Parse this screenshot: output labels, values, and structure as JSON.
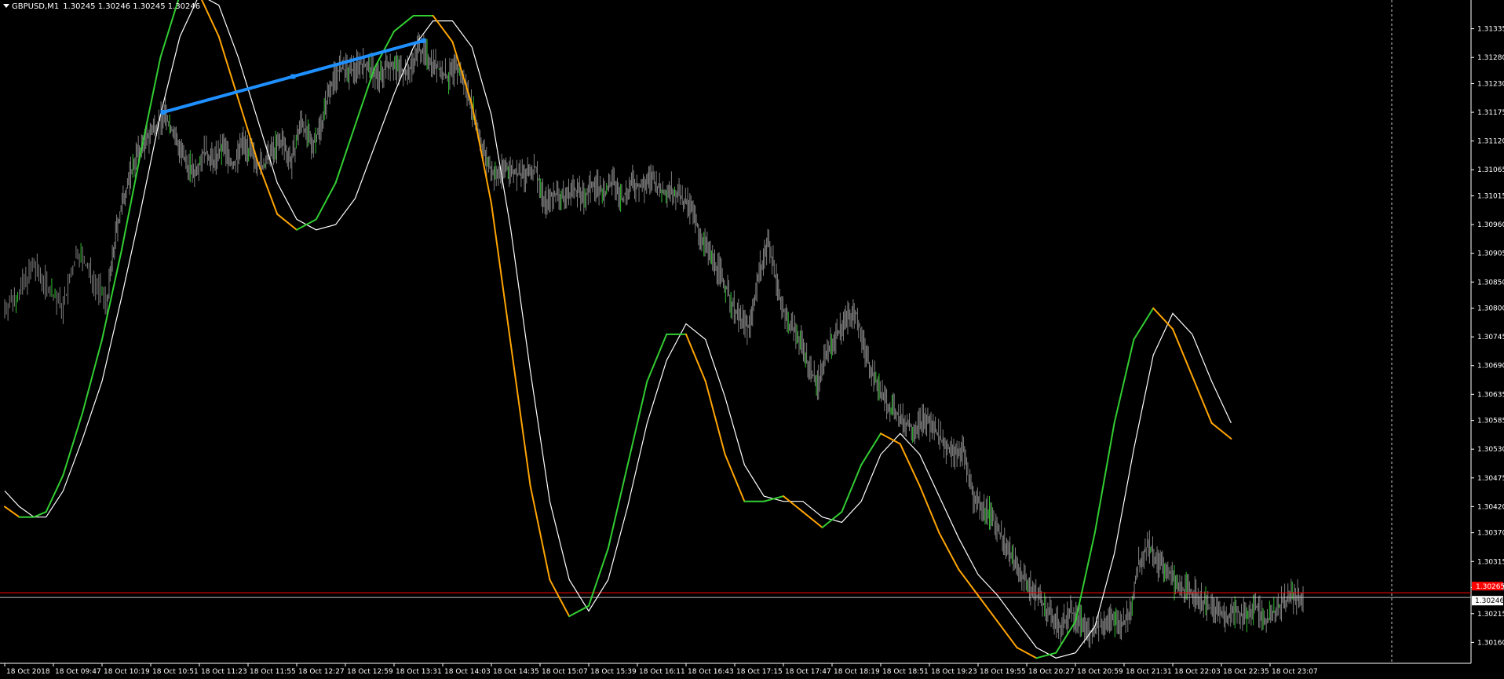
{
  "header": {
    "symbol": "GBPUSD,M1",
    "ohlc": "1.30245 1.30246 1.30245 1.30246"
  },
  "colors": {
    "background": "#000000",
    "axis": "#ffffff",
    "candles": "#808080",
    "bull_highlight": "#2ec02e",
    "slow_line": "#ffffff",
    "fast_line_up": "#32cd32",
    "fast_line_down": "#ffa500",
    "trendline": "#1e90ff",
    "price_line": "#ff0000",
    "current_price_line": "#c0c0c0"
  },
  "chart_data": {
    "type": "line",
    "instrument": "GBPUSD",
    "timeframe": "M1",
    "x_ticks": [
      "18 Oct 2018",
      "18 Oct 09:47",
      "18 Oct 10:19",
      "18 Oct 10:51",
      "18 Oct 11:23",
      "18 Oct 11:55",
      "18 Oct 12:27",
      "18 Oct 12:59",
      "18 Oct 13:31",
      "18 Oct 14:03",
      "18 Oct 14:35",
      "18 Oct 15:07",
      "18 Oct 15:39",
      "18 Oct 16:11",
      "18 Oct 16:43",
      "18 Oct 17:15",
      "18 Oct 17:47",
      "18 Oct 18:19",
      "18 Oct 18:51",
      "18 Oct 19:23",
      "18 Oct 19:55",
      "18 Oct 20:27",
      "18 Oct 20:59",
      "18 Oct 21:31",
      "18 Oct 22:03",
      "18 Oct 22:35",
      "18 Oct 23:07"
    ],
    "y_ticks": [
      "1.31335",
      "1.31280",
      "1.31230",
      "1.31175",
      "1.31120",
      "1.31065",
      "1.31015",
      "1.30960",
      "1.30905",
      "1.30850",
      "1.30800",
      "1.30745",
      "1.30690",
      "1.30635",
      "1.30585",
      "1.30530",
      "1.30475",
      "1.30420",
      "1.30370",
      "1.30315",
      "1.30265",
      "1.30215",
      "1.30160"
    ],
    "ylim": [
      1.3012,
      1.3139
    ],
    "xlim": [
      0,
      27
    ],
    "price_series_close": [
      [
        0,
        1.308
      ],
      [
        0.3,
        1.3083
      ],
      [
        0.6,
        1.3088
      ],
      [
        0.9,
        1.3084
      ],
      [
        1.2,
        1.308
      ],
      [
        1.5,
        1.3091
      ],
      [
        1.8,
        1.3086
      ],
      [
        2.1,
        1.3081
      ],
      [
        2.3,
        1.3095
      ],
      [
        2.5,
        1.3103
      ],
      [
        2.7,
        1.3109
      ],
      [
        2.9,
        1.3112
      ],
      [
        3.1,
        1.3115
      ],
      [
        3.3,
        1.3117
      ],
      [
        3.5,
        1.3113
      ],
      [
        3.7,
        1.3108
      ],
      [
        3.9,
        1.3106
      ],
      [
        4.1,
        1.311
      ],
      [
        4.3,
        1.3108
      ],
      [
        4.5,
        1.3111
      ],
      [
        4.7,
        1.3107
      ],
      [
        4.9,
        1.3112
      ],
      [
        5.1,
        1.3109
      ],
      [
        5.3,
        1.3107
      ],
      [
        5.5,
        1.311
      ],
      [
        5.7,
        1.3112
      ],
      [
        5.9,
        1.3108
      ],
      [
        6.1,
        1.3116
      ],
      [
        6.3,
        1.3111
      ],
      [
        6.5,
        1.3115
      ],
      [
        6.7,
        1.3123
      ],
      [
        6.9,
        1.3126
      ],
      [
        7.1,
        1.3125
      ],
      [
        7.3,
        1.3127
      ],
      [
        7.5,
        1.3126
      ],
      [
        7.7,
        1.3124
      ],
      [
        7.9,
        1.3127
      ],
      [
        8.1,
        1.3126
      ],
      [
        8.3,
        1.3125
      ],
      [
        8.5,
        1.313
      ],
      [
        8.7,
        1.3128
      ],
      [
        8.9,
        1.3126
      ],
      [
        9.1,
        1.3124
      ],
      [
        9.3,
        1.3126
      ],
      [
        9.5,
        1.3122
      ],
      [
        9.7,
        1.3115
      ],
      [
        9.9,
        1.3108
      ],
      [
        10.1,
        1.3105
      ],
      [
        10.3,
        1.3107
      ],
      [
        10.5,
        1.3106
      ],
      [
        10.7,
        1.3105
      ],
      [
        10.9,
        1.3107
      ],
      [
        11.1,
        1.31
      ],
      [
        11.3,
        1.3102
      ],
      [
        11.5,
        1.3101
      ],
      [
        11.7,
        1.3103
      ],
      [
        11.9,
        1.3101
      ],
      [
        12.1,
        1.3104
      ],
      [
        12.3,
        1.3102
      ],
      [
        12.5,
        1.3104
      ],
      [
        12.7,
        1.3101
      ],
      [
        12.9,
        1.3104
      ],
      [
        13.1,
        1.3103
      ],
      [
        13.3,
        1.3105
      ],
      [
        13.5,
        1.3102
      ],
      [
        13.7,
        1.3103
      ],
      [
        13.9,
        1.3101
      ],
      [
        14.1,
        1.3099
      ],
      [
        14.3,
        1.3094
      ],
      [
        14.5,
        1.309
      ],
      [
        14.7,
        1.3087
      ],
      [
        14.9,
        1.3082
      ],
      [
        15.1,
        1.3078
      ],
      [
        15.3,
        1.3076
      ],
      [
        15.5,
        1.3087
      ],
      [
        15.7,
        1.3093
      ],
      [
        15.9,
        1.3083
      ],
      [
        16.1,
        1.3077
      ],
      [
        16.3,
        1.3075
      ],
      [
        16.5,
        1.307
      ],
      [
        16.7,
        1.3065
      ],
      [
        16.9,
        1.3072
      ],
      [
        17.1,
        1.3075
      ],
      [
        17.3,
        1.3078
      ],
      [
        17.5,
        1.3079
      ],
      [
        17.7,
        1.3071
      ],
      [
        17.9,
        1.3066
      ],
      [
        18.1,
        1.3062
      ],
      [
        18.3,
        1.306
      ],
      [
        18.5,
        1.3058
      ],
      [
        18.7,
        1.3057
      ],
      [
        18.9,
        1.3059
      ],
      [
        19.1,
        1.3057
      ],
      [
        19.3,
        1.3054
      ],
      [
        19.5,
        1.3052
      ],
      [
        19.7,
        1.3053
      ],
      [
        19.9,
        1.3044
      ],
      [
        20.1,
        1.3042
      ],
      [
        20.3,
        1.304
      ],
      [
        20.5,
        1.3036
      ],
      [
        20.7,
        1.3032
      ],
      [
        20.9,
        1.3029
      ],
      [
        21.1,
        1.3026
      ],
      [
        21.3,
        1.3024
      ],
      [
        21.5,
        1.3021
      ],
      [
        21.7,
        1.3019
      ],
      [
        21.9,
        1.3022
      ],
      [
        22.1,
        1.302
      ],
      [
        22.3,
        1.3018
      ],
      [
        22.5,
        1.3019
      ],
      [
        22.7,
        1.3021
      ],
      [
        22.9,
        1.3019
      ],
      [
        23.1,
        1.3021
      ],
      [
        23.3,
        1.3031
      ],
      [
        23.5,
        1.3035
      ],
      [
        23.7,
        1.3031
      ],
      [
        23.9,
        1.303
      ],
      [
        24.1,
        1.3026
      ],
      [
        24.3,
        1.3026
      ],
      [
        24.5,
        1.3025
      ],
      [
        24.7,
        1.3023
      ],
      [
        24.9,
        1.3022
      ],
      [
        25.1,
        1.3021
      ],
      [
        25.3,
        1.3022
      ],
      [
        25.5,
        1.3021
      ],
      [
        25.7,
        1.3023
      ],
      [
        25.9,
        1.302
      ],
      [
        26.1,
        1.3022
      ],
      [
        26.3,
        1.3024
      ],
      [
        26.5,
        1.3025
      ],
      [
        26.7,
        1.3024
      ]
    ],
    "slow_line": [
      [
        0,
        1.3045
      ],
      [
        0.3,
        1.3042
      ],
      [
        0.6,
        1.304
      ],
      [
        0.85,
        1.304
      ],
      [
        1.2,
        1.3045
      ],
      [
        1.6,
        1.3055
      ],
      [
        2.0,
        1.3066
      ],
      [
        2.4,
        1.3082
      ],
      [
        2.8,
        1.3099
      ],
      [
        3.2,
        1.3117
      ],
      [
        3.6,
        1.3132
      ],
      [
        4.0,
        1.314
      ],
      [
        4.4,
        1.3138
      ],
      [
        4.8,
        1.3128
      ],
      [
        5.2,
        1.3116
      ],
      [
        5.6,
        1.3104
      ],
      [
        6.0,
        1.3097
      ],
      [
        6.4,
        1.3095
      ],
      [
        6.8,
        1.3096
      ],
      [
        7.2,
        1.3101
      ],
      [
        7.6,
        1.3111
      ],
      [
        8.0,
        1.3121
      ],
      [
        8.4,
        1.313
      ],
      [
        8.8,
        1.3135
      ],
      [
        9.2,
        1.3135
      ],
      [
        9.6,
        1.313
      ],
      [
        10.0,
        1.3117
      ],
      [
        10.4,
        1.3095
      ],
      [
        10.8,
        1.3068
      ],
      [
        11.2,
        1.3043
      ],
      [
        11.6,
        1.3028
      ],
      [
        12.0,
        1.3022
      ],
      [
        12.4,
        1.3028
      ],
      [
        12.8,
        1.3042
      ],
      [
        13.2,
        1.3058
      ],
      [
        13.6,
        1.307
      ],
      [
        14.0,
        1.3077
      ],
      [
        14.4,
        1.3074
      ],
      [
        14.8,
        1.3063
      ],
      [
        15.2,
        1.305
      ],
      [
        15.6,
        1.3044
      ],
      [
        16.0,
        1.3043
      ],
      [
        16.4,
        1.3043
      ],
      [
        16.8,
        1.304
      ],
      [
        17.2,
        1.3039
      ],
      [
        17.6,
        1.3043
      ],
      [
        18.0,
        1.3052
      ],
      [
        18.4,
        1.3056
      ],
      [
        18.8,
        1.3052
      ],
      [
        19.2,
        1.3044
      ],
      [
        19.6,
        1.3036
      ],
      [
        20.0,
        1.3029
      ],
      [
        20.4,
        1.3025
      ],
      [
        20.8,
        1.302
      ],
      [
        21.2,
        1.3015
      ],
      [
        21.6,
        1.3013
      ],
      [
        22.0,
        1.3014
      ],
      [
        22.4,
        1.3019
      ],
      [
        22.8,
        1.3033
      ],
      [
        23.2,
        1.3053
      ],
      [
        23.6,
        1.3071
      ],
      [
        24.0,
        1.3079
      ],
      [
        24.4,
        1.3075
      ],
      [
        24.8,
        1.3066
      ],
      [
        25.2,
        1.3058
      ]
    ],
    "fast_line": [
      [
        0,
        1.3042
      ],
      [
        0.3,
        1.304
      ],
      [
        0.6,
        1.304
      ],
      [
        0.85,
        1.3041
      ],
      [
        1.2,
        1.3048
      ],
      [
        1.6,
        1.306
      ],
      [
        2.0,
        1.3074
      ],
      [
        2.4,
        1.3091
      ],
      [
        2.8,
        1.311
      ],
      [
        3.2,
        1.3128
      ],
      [
        3.6,
        1.314
      ],
      [
        4.0,
        1.314
      ],
      [
        4.4,
        1.3132
      ],
      [
        4.8,
        1.312
      ],
      [
        5.2,
        1.3108
      ],
      [
        5.6,
        1.3098
      ],
      [
        6.0,
        1.3095
      ],
      [
        6.4,
        1.3097
      ],
      [
        6.8,
        1.3104
      ],
      [
        7.2,
        1.3115
      ],
      [
        7.6,
        1.3126
      ],
      [
        8.0,
        1.3133
      ],
      [
        8.4,
        1.3136
      ],
      [
        8.8,
        1.3136
      ],
      [
        9.2,
        1.3131
      ],
      [
        9.6,
        1.3119
      ],
      [
        10.0,
        1.31
      ],
      [
        10.4,
        1.3073
      ],
      [
        10.8,
        1.3046
      ],
      [
        11.2,
        1.3028
      ],
      [
        11.6,
        1.3021
      ],
      [
        12.0,
        1.3023
      ],
      [
        12.4,
        1.3034
      ],
      [
        12.8,
        1.305
      ],
      [
        13.2,
        1.3066
      ],
      [
        13.6,
        1.3075
      ],
      [
        14.0,
        1.3075
      ],
      [
        14.4,
        1.3066
      ],
      [
        14.8,
        1.3052
      ],
      [
        15.2,
        1.3043
      ],
      [
        15.6,
        1.3043
      ],
      [
        16.0,
        1.3044
      ],
      [
        16.4,
        1.3041
      ],
      [
        16.8,
        1.3038
      ],
      [
        17.2,
        1.3041
      ],
      [
        17.6,
        1.305
      ],
      [
        18.0,
        1.3056
      ],
      [
        18.4,
        1.3054
      ],
      [
        18.8,
        1.3046
      ],
      [
        19.2,
        1.3037
      ],
      [
        19.6,
        1.303
      ],
      [
        20.0,
        1.3025
      ],
      [
        20.4,
        1.302
      ],
      [
        20.8,
        1.3015
      ],
      [
        21.2,
        1.3013
      ],
      [
        21.6,
        1.3014
      ],
      [
        22.0,
        1.302
      ],
      [
        22.4,
        1.3037
      ],
      [
        22.8,
        1.3058
      ],
      [
        23.2,
        1.3074
      ],
      [
        23.6,
        1.308
      ],
      [
        24.0,
        1.3076
      ],
      [
        24.4,
        1.3067
      ],
      [
        24.8,
        1.3058
      ],
      [
        25.2,
        1.3055
      ]
    ],
    "trendline": [
      [
        3.25,
        1.31175
      ],
      [
        8.6,
        1.31312
      ]
    ],
    "bid_price": 1.30246,
    "red_level": 1.30255,
    "current_price_label": "1.30246",
    "red_price_label": "1.30265"
  }
}
